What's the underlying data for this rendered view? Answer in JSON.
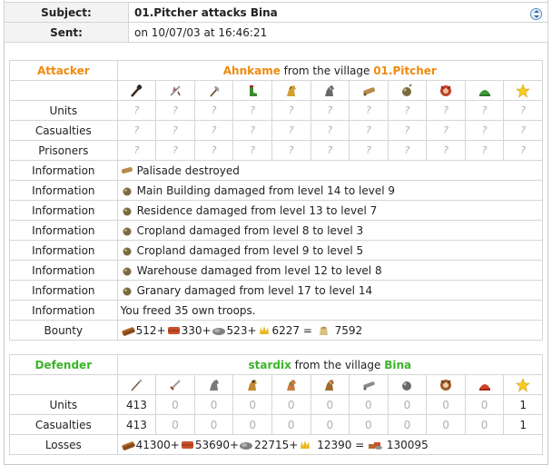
{
  "header": {
    "subject_label": "Subject:",
    "subject_value": "01.Pitcher attacks Bina",
    "sent_label": "Sent:",
    "sent_value": "on 10/07/03 at 16:46:21"
  },
  "attacker": {
    "role": "Attacker",
    "player": "Ahnkame",
    "from_text": " from the village ",
    "village": "01.Pitcher",
    "units_label": "Units",
    "casualties_label": "Casualties",
    "prisoners_label": "Prisoners",
    "unit_icons": [
      "club-icon",
      "axe-icon",
      "axe2-icon",
      "boot-icon",
      "horse-icon",
      "horse-armored-icon",
      "ram-icon",
      "catapult-icon",
      "chief-icon",
      "settler-icon",
      "hero-icon"
    ],
    "units": [
      "?",
      "?",
      "?",
      "?",
      "?",
      "?",
      "?",
      "?",
      "?",
      "?",
      "?"
    ],
    "casualties": [
      "?",
      "?",
      "?",
      "?",
      "?",
      "?",
      "?",
      "?",
      "?",
      "?",
      "?"
    ],
    "prisoners": [
      "?",
      "?",
      "?",
      "?",
      "?",
      "?",
      "?",
      "?",
      "?",
      "?",
      "?"
    ],
    "info_label": "Information",
    "info": [
      {
        "icon": "ram-icon",
        "text": "Palisade destroyed"
      },
      {
        "icon": "catapult-icon",
        "text": "Main Building damaged from level 14 to level 9"
      },
      {
        "icon": "catapult-icon",
        "text": "Residence damaged from level 13 to level 7"
      },
      {
        "icon": "catapult-icon",
        "text": "Cropland damaged from level 8 to level 3"
      },
      {
        "icon": "catapult-icon",
        "text": "Cropland damaged from level 9 to level 5"
      },
      {
        "icon": "catapult-icon",
        "text": "Warehouse damaged from level 12 to level 8"
      },
      {
        "icon": "catapult-icon",
        "text": "Granary damaged from level 17 to level 14"
      },
      {
        "icon": "",
        "text": "You freed 35 own troops."
      }
    ],
    "bounty_label": "Bounty",
    "bounty": {
      "wood": "512",
      "clay": "330",
      "iron": "523",
      "crop": "6227",
      "total": "7592"
    }
  },
  "defender": {
    "role": "Defender",
    "player": "stardix",
    "from_text": " from the village ",
    "village": "Bina",
    "units_label": "Units",
    "casualties_label": "Casualties",
    "losses_label": "Losses",
    "unit_icons": [
      "spear-icon",
      "sword-icon",
      "horse-icon",
      "scout-icon",
      "horse2-icon",
      "horse-armored-icon",
      "ram-icon",
      "catapult-icon",
      "chief-icon",
      "settler-icon",
      "hero-icon"
    ],
    "units": [
      "413",
      "0",
      "0",
      "0",
      "0",
      "0",
      "0",
      "0",
      "0",
      "0",
      "1"
    ],
    "casualties": [
      "413",
      "0",
      "0",
      "0",
      "0",
      "0",
      "0",
      "0",
      "0",
      "0",
      "1"
    ],
    "losses": {
      "wood": "41300",
      "clay": "53690",
      "iron": "22715",
      "crop": "12390",
      "total": "130095"
    }
  },
  "colors": {
    "attacker": "#f08a10",
    "defender": "#3bb42a"
  }
}
